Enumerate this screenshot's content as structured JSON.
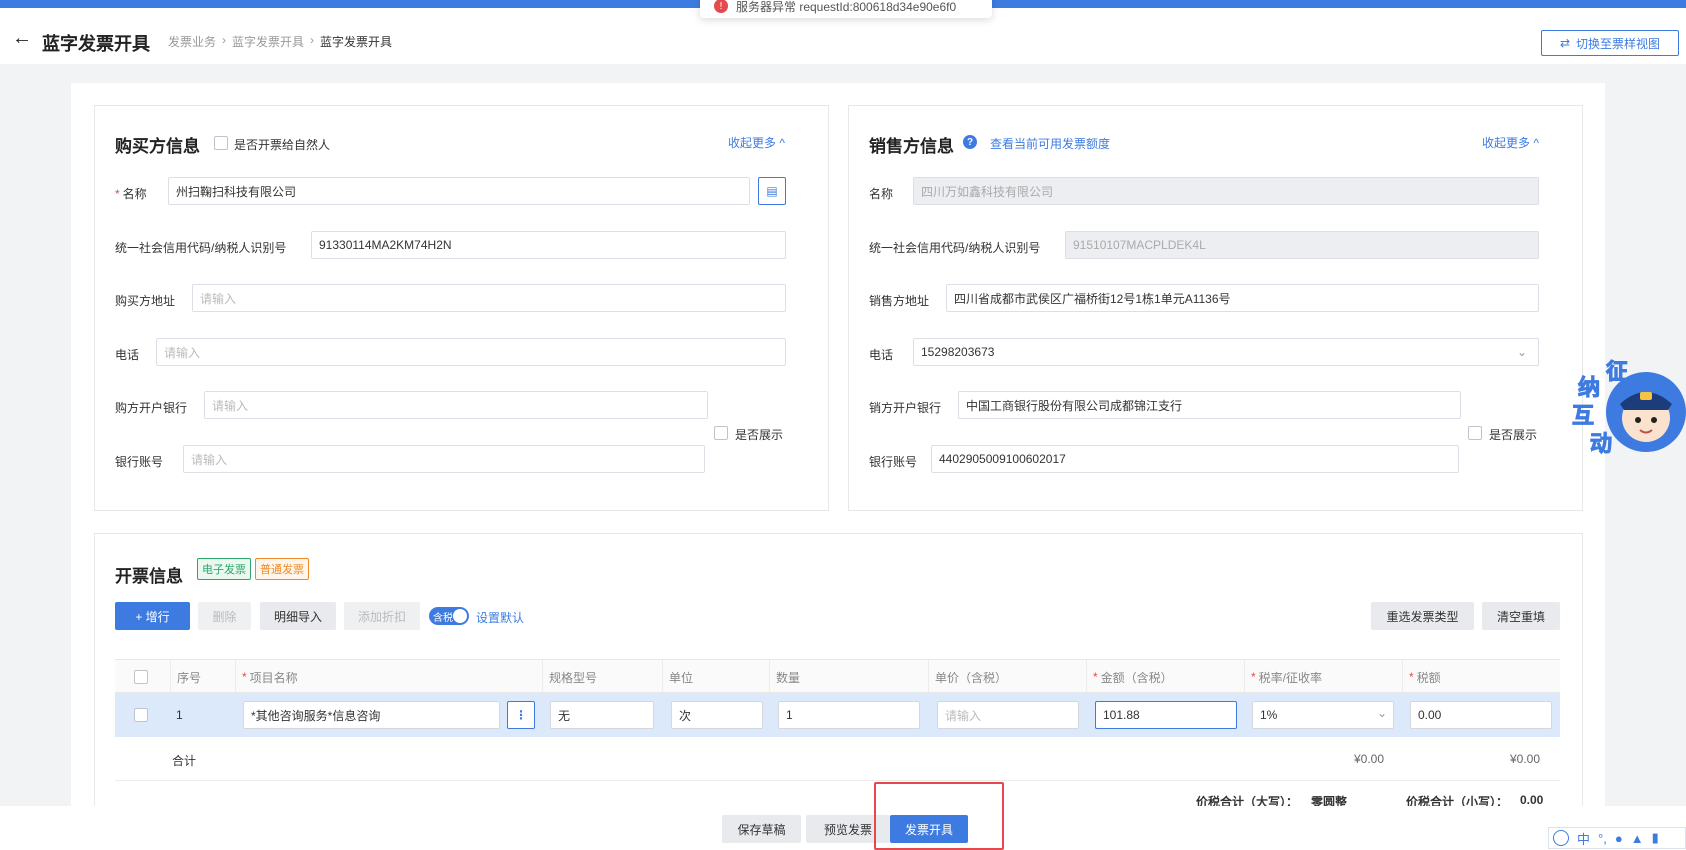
{
  "header": {
    "title": "蓝字发票开具",
    "breadcrumb": [
      "发票业务",
      "蓝字发票开具",
      "蓝字发票开具"
    ],
    "switch_view_label": "切换至票样视图"
  },
  "toast": {
    "message": "服务器异常 requestId:800618d34e90e6f0"
  },
  "buyer": {
    "title": "购买方信息",
    "natural_person_label": "是否开票给自然人",
    "collapse_label": "收起更多 ^",
    "name_label": "名称",
    "name_value": "州扫鞠扫科技有限公司",
    "tax_id_label": "统一社会信用代码/纳税人识别号",
    "tax_id_value": "91330114MA2KM74H2N",
    "address_label": "购买方地址",
    "address_placeholder": "请输入",
    "phone_label": "电话",
    "phone_placeholder": "请输入",
    "bank_label": "购方开户银行",
    "bank_placeholder": "请输入",
    "show_label": "是否展示",
    "account_label": "银行账号",
    "account_placeholder": "请输入"
  },
  "seller": {
    "title": "销售方信息",
    "quota_link": "查看当前可用发票额度",
    "collapse_label": "收起更多 ^",
    "name_label": "名称",
    "name_value": "四川万如鑫科技有限公司",
    "tax_id_label": "统一社会信用代码/纳税人识别号",
    "tax_id_value": "91510107MACPLDEK4L",
    "address_label": "销售方地址",
    "address_value": "四川省成都市武侯区广福桥街12号1栋1单元A1136号",
    "phone_label": "电话",
    "phone_value": "15298203673",
    "bank_label": "销方开户银行",
    "bank_value": "中国工商银行股份有限公司成都锦江支行",
    "show_label": "是否展示",
    "account_label": "银行账号",
    "account_value": "4402905009100602017"
  },
  "invoice": {
    "title": "开票信息",
    "tags": [
      "电子发票",
      "普通发票"
    ],
    "add_row_label": "+ 增行",
    "delete_label": "删除",
    "detail_import_label": "明细导入",
    "add_discount_label": "添加折扣",
    "tax_toggle_label": "含税",
    "set_default_label": "设置默认",
    "reselect_label": "重选发票类型",
    "clear_label": "清空重填",
    "columns": [
      "序号",
      "项目名称",
      "规格型号",
      "单位",
      "数量",
      "单价（含税）",
      "金额（含税）",
      "税率/征收率",
      "税额"
    ],
    "row": {
      "index": "1",
      "item_name": "*其他咨询服务*信息咨询",
      "spec": "无",
      "unit": "次",
      "quantity": "1",
      "unit_price_placeholder": "请输入",
      "amount": "101.88",
      "tax_rate": "1%",
      "tax_amount": "0.00"
    },
    "total_label": "合计",
    "total_amount": "¥0.00",
    "total_tax": "¥0.00",
    "total_upper_label": "价税合计（大写）：",
    "total_upper_value": "零圆整",
    "total_lower_label": "价税合计（小写）：",
    "total_lower_value": "0.00"
  },
  "footer": {
    "save_draft": "保存草稿",
    "preview": "预览发票",
    "issue": "发票开具"
  },
  "mascot": {
    "text": [
      "征",
      "纳",
      "互",
      "动"
    ]
  },
  "ime": {
    "lang": "中"
  }
}
